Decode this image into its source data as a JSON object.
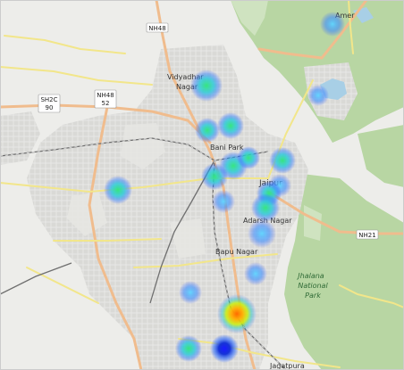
{
  "map": {
    "places": [
      {
        "id": "amer",
        "text": "Amer"
      },
      {
        "id": "vidyadhar-1",
        "text": "Vidyadhar"
      },
      {
        "id": "vidyadhar-2",
        "text": "Nagar"
      },
      {
        "id": "bani-park",
        "text": "Bani Park"
      },
      {
        "id": "jaipur",
        "text": "Jaipur"
      },
      {
        "id": "adarsh-nagar",
        "text": "Adarsh Nagar"
      },
      {
        "id": "bapu-nagar",
        "text": "Bapu Nagar"
      },
      {
        "id": "jagatpura",
        "text": "Jagatpura"
      }
    ],
    "park": {
      "line1": "Jhalana",
      "line2": "National",
      "line3": "Park"
    },
    "shields": [
      {
        "id": "nh48-top",
        "text": "NH48"
      },
      {
        "id": "sh2c",
        "text": "SH2C"
      },
      {
        "id": "sh2c-num",
        "text": "90"
      },
      {
        "id": "nh48-mid",
        "text": "NH48"
      },
      {
        "id": "nh48-mid-num",
        "text": "52"
      },
      {
        "id": "nh21",
        "text": "NH21"
      }
    ],
    "heatmap_spots": [
      {
        "name": "amer",
        "intensity": 0.35
      },
      {
        "name": "vidyadhar-nagar",
        "intensity": 0.55
      },
      {
        "name": "jal-mahal",
        "intensity": 0.3
      },
      {
        "name": "bani-park-1",
        "intensity": 0.45
      },
      {
        "name": "bani-park-2",
        "intensity": 0.5
      },
      {
        "name": "west",
        "intensity": 0.5
      },
      {
        "name": "station",
        "intensity": 0.55
      },
      {
        "name": "center-1",
        "intensity": 0.6
      },
      {
        "name": "center-2",
        "intensity": 0.5
      },
      {
        "name": "old-city-1",
        "intensity": 0.5
      },
      {
        "name": "old-city-2",
        "intensity": 0.45
      },
      {
        "name": "old-city-3",
        "intensity": 0.5
      },
      {
        "name": "jaipur-center",
        "intensity": 0.6
      },
      {
        "name": "south-station",
        "intensity": 0.45
      },
      {
        "name": "adarsh-nagar-1",
        "intensity": 0.6
      },
      {
        "name": "adarsh-nagar-2",
        "intensity": 0.55
      },
      {
        "name": "bapu-nagar",
        "intensity": 0.3
      },
      {
        "name": "gandhi-nagar",
        "intensity": 0.4
      },
      {
        "name": "malviya-1",
        "intensity": 0.35
      },
      {
        "name": "malviya-hot",
        "intensity": 1.0
      },
      {
        "name": "sanganer-1",
        "intensity": 0.55
      },
      {
        "name": "sanganer-2",
        "intensity": 0.15
      }
    ],
    "colors": {
      "land": "#eeeeea",
      "urban": "#d8d8d8",
      "forest": "#b9d7a6",
      "water": "#a9cfe6",
      "major_road": "#f1bd8e",
      "secondary_road": "#f3e98a",
      "railway": "#777777"
    }
  }
}
